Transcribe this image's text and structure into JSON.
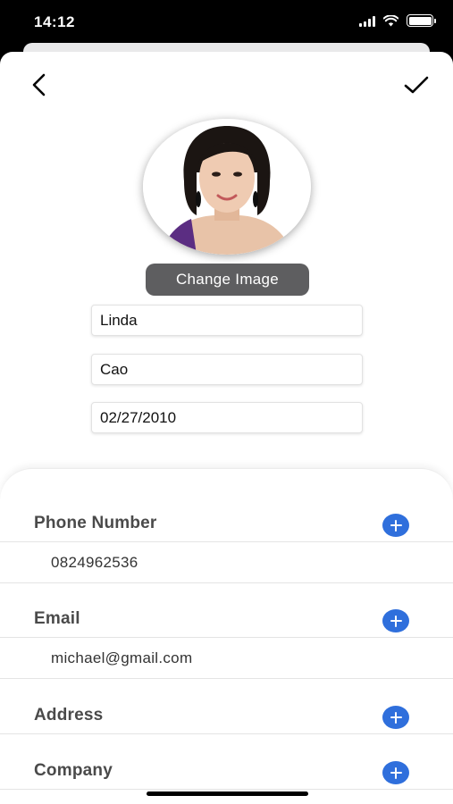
{
  "status_bar": {
    "time": "14:12"
  },
  "profile": {
    "change_image_label": "Change Image",
    "first_name": "Linda",
    "last_name": "Cao",
    "birthday": "02/27/2010"
  },
  "sections": {
    "phone": {
      "title": "Phone Number",
      "value": "0824962536"
    },
    "email": {
      "title": "Email",
      "value": "michael@gmail.com"
    },
    "address": {
      "title": "Address"
    },
    "company": {
      "title": "Company"
    }
  },
  "colors": {
    "accent": "#2f6fdc",
    "button_dark": "#5e5e60"
  },
  "icons": [
    "back-chevron-icon",
    "checkmark-icon",
    "plus-icon",
    "cellular-signal-icon",
    "wifi-icon",
    "battery-icon"
  ]
}
